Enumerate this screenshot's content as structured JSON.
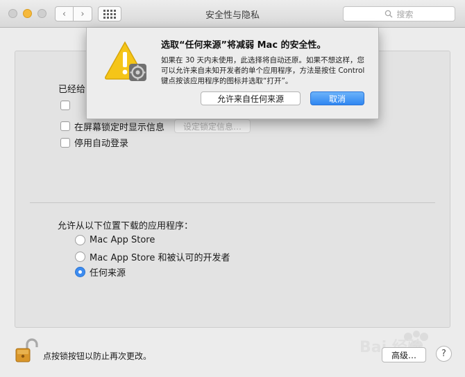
{
  "window": {
    "title": "安全性与隐私",
    "nav_back": "‹",
    "nav_forward": "›",
    "search_placeholder": "搜索"
  },
  "general": {
    "heading": "已经给",
    "checkboxes": [
      {
        "label": "",
        "checked": false
      },
      {
        "label": "在屏幕锁定时显示信息",
        "checked": false
      },
      {
        "label": "停用自动登录",
        "checked": false
      }
    ],
    "set_lock_message_button": "设定锁定信息…"
  },
  "download": {
    "heading": "允许从以下位置下载的应用程序：",
    "options": [
      {
        "label": "Mac App Store",
        "selected": false
      },
      {
        "label": "Mac App Store 和被认可的开发者",
        "selected": false
      },
      {
        "label": "任何来源",
        "selected": true
      }
    ]
  },
  "footer": {
    "lock_text": "点按锁按钮以防止再次更改。",
    "advanced_button": "高级…",
    "help_button": "?"
  },
  "dialog": {
    "title": "选取“任何来源”将减弱 Mac 的安全性。",
    "body": "如果在 30 天内未使用，此选择将自动还原。如果不想这样，您可以允许来自未知开发者的单个应用程序，方法是按住 Control 键点按该应用程序的图标并选取“打开”。",
    "allow_button": "允许来自任何来源",
    "cancel_button": "取消"
  },
  "watermark": {
    "text": "Bai 经验"
  },
  "colors": {
    "accent": "#3d8cf0",
    "traffic_minimize": "#f6b93b",
    "warning_yellow": "#f5c518"
  }
}
